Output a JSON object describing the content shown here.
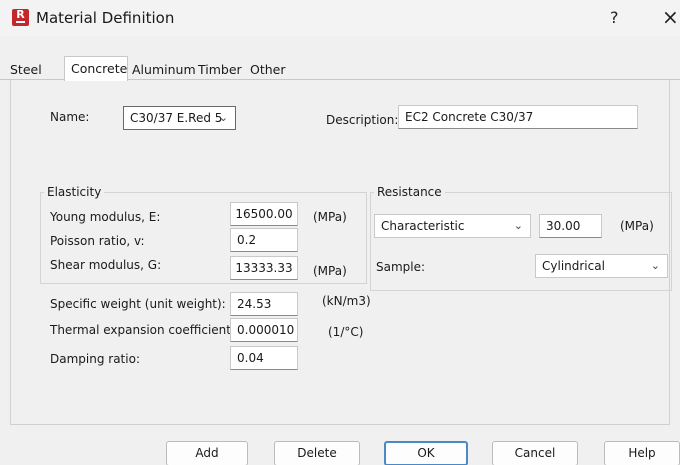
{
  "window": {
    "title": "Material Definition",
    "help": "?",
    "close": "×",
    "app_icon_letter": "R"
  },
  "tabs": [
    {
      "label": "Steel"
    },
    {
      "label": "Concrete"
    },
    {
      "label": "Aluminum"
    },
    {
      "label": "Timber"
    },
    {
      "label": "Other"
    }
  ],
  "name": {
    "label": "Name:",
    "value": "C30/37 E.Red 5"
  },
  "description": {
    "label": "Description:",
    "value": "EC2 Concrete C30/37"
  },
  "elasticity": {
    "title": "Elasticity",
    "young": {
      "label": "Young modulus, E:",
      "value": "16500.00",
      "unit": "(MPa)"
    },
    "poisson": {
      "label": "Poisson ratio, v:",
      "value": "0.2"
    },
    "shear": {
      "label": "Shear modulus, G:",
      "value": "13333.33",
      "unit": "(MPa)"
    }
  },
  "resistance": {
    "title": "Resistance",
    "type": "Characteristic",
    "value": "30.00",
    "unit": "(MPa)",
    "sample_label": "Sample:",
    "sample_value": "Cylindrical"
  },
  "other": {
    "weight": {
      "label": "Specific weight (unit weight):",
      "value": "24.53",
      "unit": "(kN/m3)"
    },
    "thermal": {
      "label": "Thermal expansion coefficient:",
      "value": "0.000010",
      "unit": "(1/°C)"
    },
    "damping": {
      "label": "Damping ratio:",
      "value": "0.04"
    }
  },
  "buttons": {
    "add": "Add",
    "delete": "Delete",
    "ok": "OK",
    "cancel": "Cancel",
    "help": "Help"
  }
}
